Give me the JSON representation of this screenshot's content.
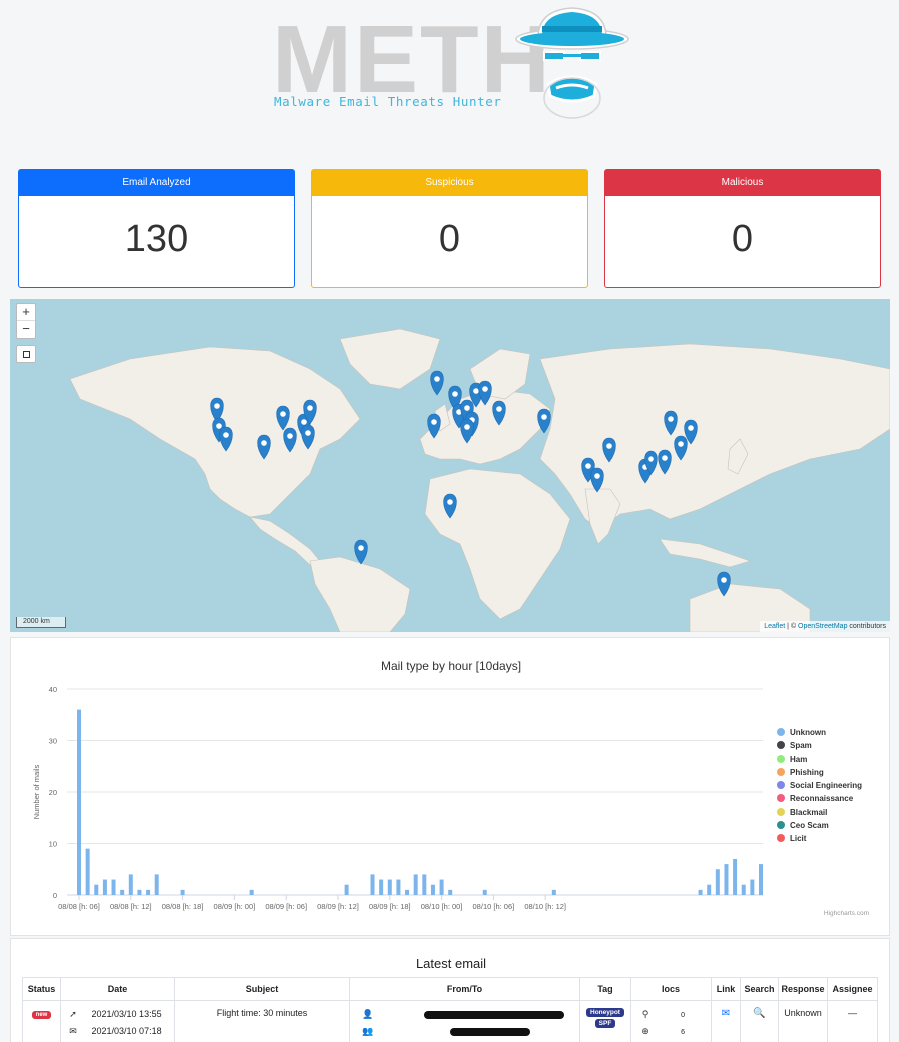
{
  "logo": {
    "title": "METH",
    "subtitle": "Malware Email Threats Hunter"
  },
  "stats": [
    {
      "label": "Email Analyzed",
      "value": "130"
    },
    {
      "label": "Suspicious",
      "value": "0"
    },
    {
      "label": "Malicious",
      "value": "0"
    }
  ],
  "map": {
    "zoom_in": "+",
    "zoom_out": "−",
    "scale_label": "2000 km",
    "attribution_leaflet": "Leaflet",
    "attribution_sep": " | © ",
    "attribution_osm": "OpenStreetMap",
    "attribution_tail": " contributors",
    "colors": {
      "water": "#aad3df",
      "land": "#f2efe9",
      "marker": "#2a81cb"
    }
  },
  "chart": {
    "title": "Mail type by hour [10days]",
    "credits": "Highcharts.com",
    "legend": [
      {
        "name": "Unknown",
        "color": "#7cb5ec"
      },
      {
        "name": "Spam",
        "color": "#434348"
      },
      {
        "name": "Ham",
        "color": "#90ed7d"
      },
      {
        "name": "Phishing",
        "color": "#f7a35c"
      },
      {
        "name": "Social Engineering",
        "color": "#8085e9"
      },
      {
        "name": "Reconnaissance",
        "color": "#f15c80"
      },
      {
        "name": "Blackmail",
        "color": "#e4d354"
      },
      {
        "name": "Ceo Scam",
        "color": "#2b908f"
      },
      {
        "name": "Licit",
        "color": "#f45b5b"
      }
    ]
  },
  "chart_data": {
    "type": "bar",
    "title": "Mail type by hour [10days]",
    "ylabel": "Number of mails",
    "xlabel": "",
    "ylim": [
      0,
      40
    ],
    "yticks": [
      0,
      10,
      20,
      30,
      40
    ],
    "x_tick_labels": [
      "08/08 [h: 06]",
      "08/08 [h: 12]",
      "08/08 [h: 18]",
      "08/09 [h: 00]",
      "08/09 [h: 06]",
      "08/09 [h: 12]",
      "08/09 [h: 18]",
      "08/10 [h: 00]",
      "08/10 [h: 06]",
      "08/10 [h: 12]"
    ],
    "grid": true,
    "legend_position": "right",
    "series": [
      {
        "name": "Unknown",
        "values": [
          36,
          9,
          2,
          3,
          3,
          1,
          4,
          1,
          1,
          4,
          0,
          0,
          1,
          0,
          0,
          0,
          0,
          0,
          0,
          0,
          1,
          0,
          0,
          0,
          0,
          0,
          0,
          0,
          0,
          0,
          0,
          2,
          0,
          0,
          4,
          3,
          3,
          3,
          1,
          4,
          4,
          2,
          3,
          1,
          0,
          0,
          0,
          1,
          0,
          0,
          0,
          0,
          0,
          0,
          0,
          1,
          0,
          0,
          0,
          0,
          0,
          0,
          0,
          0,
          0,
          0,
          0,
          0,
          0,
          0,
          0,
          0,
          1,
          2,
          5,
          6,
          7,
          2,
          3,
          6
        ]
      }
    ]
  },
  "latest_email": {
    "title": "Latest email",
    "columns": [
      "Status",
      "Date",
      "Subject",
      "From/To",
      "Tag",
      "Iocs",
      "Link",
      "Search",
      "Response",
      "Assignee"
    ],
    "rows": [
      {
        "status": "new",
        "date_sent": "2021/03/10 13:55",
        "date_received": "2021/03/10 07:18",
        "subject": "Flight time: 30 minutes",
        "tags": [
          "Honeypot",
          "SPF"
        ],
        "ioc_ip": "0",
        "ioc_url": "6",
        "response": "Unknown",
        "assignee": "—"
      }
    ]
  }
}
